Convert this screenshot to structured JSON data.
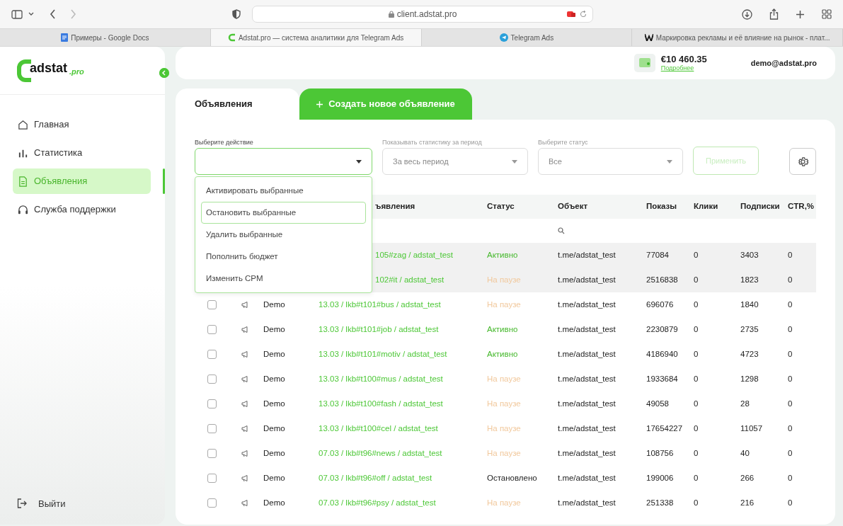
{
  "browser": {
    "address": "client.adstat.pro",
    "tabs": [
      {
        "label": "Примеры - Google Docs",
        "selected": false
      },
      {
        "label": "Adstat.pro — система аналитики для Telegram Ads",
        "selected": true
      },
      {
        "label": "Telegram Ads",
        "selected": false
      },
      {
        "label": "Маркировка рекламы и её влияние на рынок - плат...",
        "selected": false
      }
    ]
  },
  "sidebar": {
    "logo": {
      "name": "adstat",
      "suffix": ".pro"
    },
    "items": [
      {
        "label": "Главная",
        "selected": false
      },
      {
        "label": "Статистика",
        "selected": false
      },
      {
        "label": "Объявления",
        "selected": true
      },
      {
        "label": "Служба поддержки",
        "selected": false
      }
    ],
    "logout": "Выйти"
  },
  "header": {
    "balance": "€10 460.35",
    "details_link": "Подробнее",
    "user": "demo@adstat.pro"
  },
  "page_tabs": [
    {
      "label": "Объявления",
      "kind": "tab",
      "selected": true
    },
    {
      "label": "Создать новое объявление",
      "kind": "create",
      "selected": false
    }
  ],
  "filters": {
    "action": {
      "label": "Выберите действие",
      "expanded": true,
      "options": [
        {
          "label": "Активировать выбранные",
          "selected": false
        },
        {
          "label": "Остановить выбранные",
          "selected": true
        },
        {
          "label": "Удалить выбранные",
          "selected": false
        },
        {
          "label": "Пополнить бюджет",
          "selected": false
        },
        {
          "label": "Изменить CPM",
          "selected": false
        }
      ]
    },
    "period": {
      "label": "Показывать статистику за период",
      "value": "За весь период"
    },
    "status": {
      "label": "Выберите статус",
      "value": "Все"
    },
    "apply": {
      "label": "Применить",
      "disabled": true
    }
  },
  "table": {
    "columns": [
      "ъявления",
      "Статус",
      "Объект",
      "Показы",
      "Клики",
      "Подписки",
      "CTR,%"
    ],
    "rows": [
      {
        "highlighted": true,
        "ad": "105#zag / adstat_test",
        "status": "Активно",
        "color": "#45b82c",
        "object": "t.me/adstat_test",
        "shows": "77084",
        "clicks": "0",
        "subs": "3403",
        "ctr": "0"
      },
      {
        "highlighted": true,
        "ad": "102#it / adstat_test",
        "status": "На паузе",
        "color": "#f1c89c",
        "object": "t.me/adstat_test",
        "shows": "2516838",
        "clicks": "0",
        "subs": "1823",
        "ctr": "0"
      },
      {
        "highlighted": false,
        "checked": false,
        "name": "Demo",
        "ad": "13.03 / lkb#t101#bus / adstat_test",
        "status": "На паузе",
        "color": "#f1c89c",
        "object": "t.me/adstat_test",
        "shows": "696076",
        "clicks": "0",
        "subs": "1840",
        "ctr": "0"
      },
      {
        "highlighted": false,
        "checked": false,
        "name": "Demo",
        "ad": "13.03 / lkb#t101#job / adstat_test",
        "status": "Активно",
        "color": "#45b82c",
        "object": "t.me/adstat_test",
        "shows": "2230879",
        "clicks": "0",
        "subs": "2735",
        "ctr": "0"
      },
      {
        "highlighted": false,
        "checked": false,
        "name": "Demo",
        "ad": "13.03 / lkb#t101#motiv / adstat_test",
        "status": "Активно",
        "color": "#45b82c",
        "object": "t.me/adstat_test",
        "shows": "4186940",
        "clicks": "0",
        "subs": "4723",
        "ctr": "0"
      },
      {
        "highlighted": false,
        "checked": false,
        "name": "Demo",
        "ad": "13.03 / lkb#t100#mus / adstat_test",
        "status": "На паузе",
        "color": "#f1c89c",
        "object": "t.me/adstat_test",
        "shows": "1933684",
        "clicks": "0",
        "subs": "1298",
        "ctr": "0"
      },
      {
        "highlighted": false,
        "checked": false,
        "name": "Demo",
        "ad": "13.03 / lkb#t100#fash / adstat_test",
        "status": "На паузе",
        "color": "#f1c89c",
        "object": "t.me/adstat_test",
        "shows": "49058",
        "clicks": "0",
        "subs": "28",
        "ctr": "0"
      },
      {
        "highlighted": false,
        "checked": false,
        "name": "Demo",
        "ad": "13.03 / lkb#t100#cel / adstat_test",
        "status": "На паузе",
        "color": "#f1c89c",
        "object": "t.me/adstat_test",
        "shows": "17654227",
        "clicks": "0",
        "subs": "11057",
        "ctr": "0"
      },
      {
        "highlighted": false,
        "checked": false,
        "name": "Demo",
        "ad": "07.03 / lkb#t96#news / adstat_test",
        "status": "На паузе",
        "color": "#f1c89c",
        "object": "t.me/adstat_test",
        "shows": "108756",
        "clicks": "0",
        "subs": "40",
        "ctr": "0"
      },
      {
        "highlighted": false,
        "checked": false,
        "name": "Demo",
        "ad": "07.03 / lkb#t96#off / adstat_test",
        "status": "Остановлено",
        "color": "#222222",
        "object": "t.me/adstat_test",
        "shows": "199006",
        "clicks": "0",
        "subs": "266",
        "ctr": "0"
      },
      {
        "highlighted": false,
        "checked": false,
        "name": "Demo",
        "ad": "07.03 / lkb#t96#psy / adstat_test",
        "status": "На паузе",
        "color": "#f1c89c",
        "object": "t.me/adstat_test",
        "shows": "251338",
        "clicks": "0",
        "subs": "216",
        "ctr": "0"
      }
    ]
  }
}
